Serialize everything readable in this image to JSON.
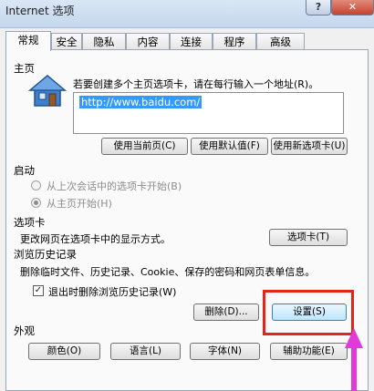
{
  "window": {
    "title": "Internet 选项",
    "help_label": "?",
    "close_label": "✕"
  },
  "tabs": [
    {
      "label": "常规",
      "active": true
    },
    {
      "label": "安全"
    },
    {
      "label": "隐私"
    },
    {
      "label": "内容"
    },
    {
      "label": "连接"
    },
    {
      "label": "程序"
    },
    {
      "label": "高级"
    }
  ],
  "homepage": {
    "section_title": "主页",
    "instruction": "若要创建多个主页选项卡，请在每行输入一个地址(R)。",
    "url_value": "http://www.baidu.com/",
    "use_current_label": "使用当前页(C)",
    "use_default_label": "使用默认值(F)",
    "use_new_tab_label": "使用新选项卡(U)"
  },
  "startup": {
    "section_title": "启动",
    "option_last_session": "从上次会话中的选项卡开始(B)",
    "option_home_page": "从主页开始(H)"
  },
  "tabs_section": {
    "section_title": "选项卡",
    "description": "更改网页在选项卡中的显示方式。",
    "tabs_button_label": "选项卡(T)"
  },
  "history": {
    "section_title": "浏览历史记录",
    "description": "删除临时文件、历史记录、Cookie、保存的密码和网页表单信息。",
    "delete_on_exit_label": "退出时删除浏览历史记录(W)",
    "delete_on_exit_checked": true,
    "delete_button_label": "删除(D)...",
    "settings_button_label": "设置(S)"
  },
  "appearance": {
    "section_title": "外观",
    "colors_label": "颜色(O)",
    "languages_label": "语言(L)",
    "fonts_label": "字体(N)",
    "accessibility_label": "辅助功能(E)"
  },
  "colors": {
    "highlight": "#e1251b",
    "annotation_arrow": "#e23ad8",
    "selection": "#3399ff"
  }
}
